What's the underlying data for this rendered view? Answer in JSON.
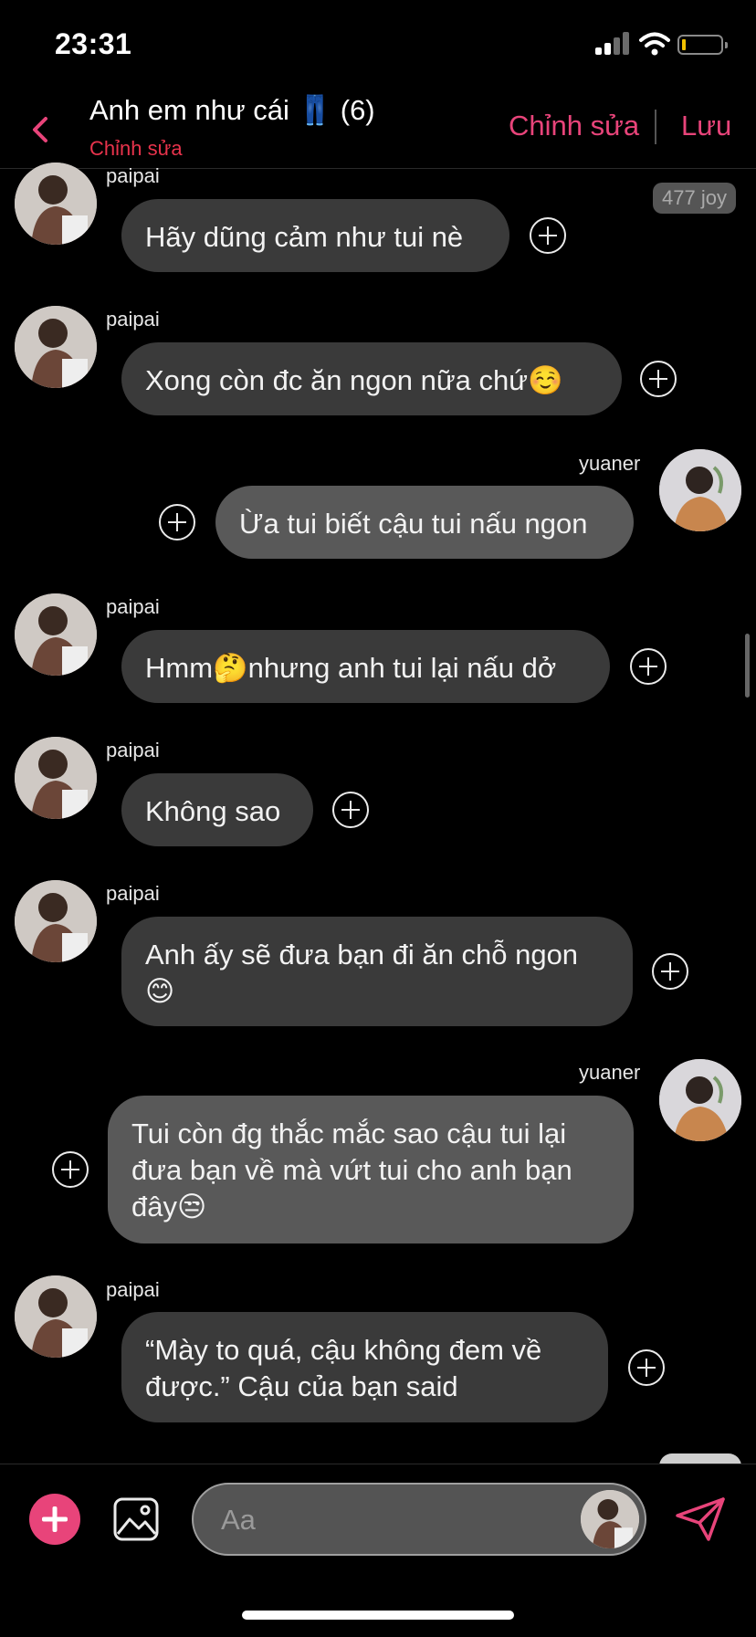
{
  "status": {
    "time": "23:31"
  },
  "header": {
    "title": "Anh em như cái 👖 (6)",
    "subtitle": "Chỉnh sửa",
    "edit_label": "Chỉnh sửa",
    "save_label": "Lưu"
  },
  "tag": "477 joy",
  "messages": [
    {
      "sender": "paipai",
      "text": "Hãy dũng cảm như tui nè"
    },
    {
      "sender": "paipai",
      "text": "Xong còn đc ăn ngon nữa chứ☺️"
    },
    {
      "sender": "yuaner",
      "text": "Ừa tui biết cậu tui nấu ngon"
    },
    {
      "sender": "paipai",
      "text": "Hmm🤔nhưng anh tui lại nấu dở"
    },
    {
      "sender": "paipai",
      "text": "Không sao"
    },
    {
      "sender": "paipai",
      "text": "Anh ấy sẽ đưa bạn đi ăn chỗ ngon 😊"
    },
    {
      "sender": "yuaner",
      "text": "Tui còn đg thắc mắc sao cậu tui lại đưa bạn về mà vứt tui cho anh bạn đây😒"
    },
    {
      "sender": "paipai",
      "text": "“Mày to quá, cậu không đem về được.” Cậu của bạn said"
    }
  ],
  "composer": {
    "placeholder": "Aa"
  },
  "colors": {
    "accent": "#e8447a",
    "bubble_left": "#3a3a3a",
    "bubble_right": "#595959"
  }
}
